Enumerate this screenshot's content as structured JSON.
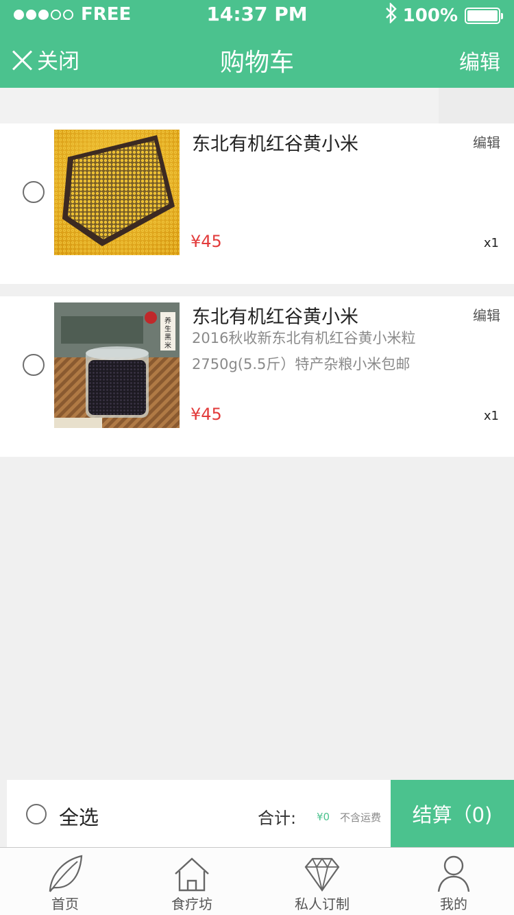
{
  "status_bar": {
    "carrier": "FREE",
    "time": "14:37 PM",
    "battery": "100%"
  },
  "nav": {
    "close_label": "关闭",
    "title": "购物车",
    "edit_label": "编辑"
  },
  "cart_items": [
    {
      "title": "东北有机红谷黄小米",
      "description": "",
      "price": "¥45",
      "quantity": "x1",
      "edit_label": "编辑",
      "image_icon": "millet-product-image"
    },
    {
      "title": "东北有机红谷黄小米",
      "description": "2016秋收新东北有机红谷黄小米粒 2750g(5.5斤）特产杂粮小米包邮",
      "price": "¥45",
      "quantity": "x1",
      "edit_label": "编辑",
      "image_icon": "black-rice-jar-product-image"
    }
  ],
  "footer": {
    "select_all_label": "全选",
    "total_label": "合计:",
    "total_value": "¥0",
    "shipping_note": "不含运费",
    "checkout_label": "结算（0)"
  },
  "tabbar": {
    "items": [
      {
        "label": "首页",
        "icon": "leaf-icon"
      },
      {
        "label": "食疗坊",
        "icon": "house-icon"
      },
      {
        "label": "私人订制",
        "icon": "diamond-icon"
      },
      {
        "label": "我的",
        "icon": "user-icon"
      }
    ]
  },
  "colors": {
    "accent": "#4bc28e",
    "price": "#e23b3b",
    "background": "#f0f0f0"
  }
}
